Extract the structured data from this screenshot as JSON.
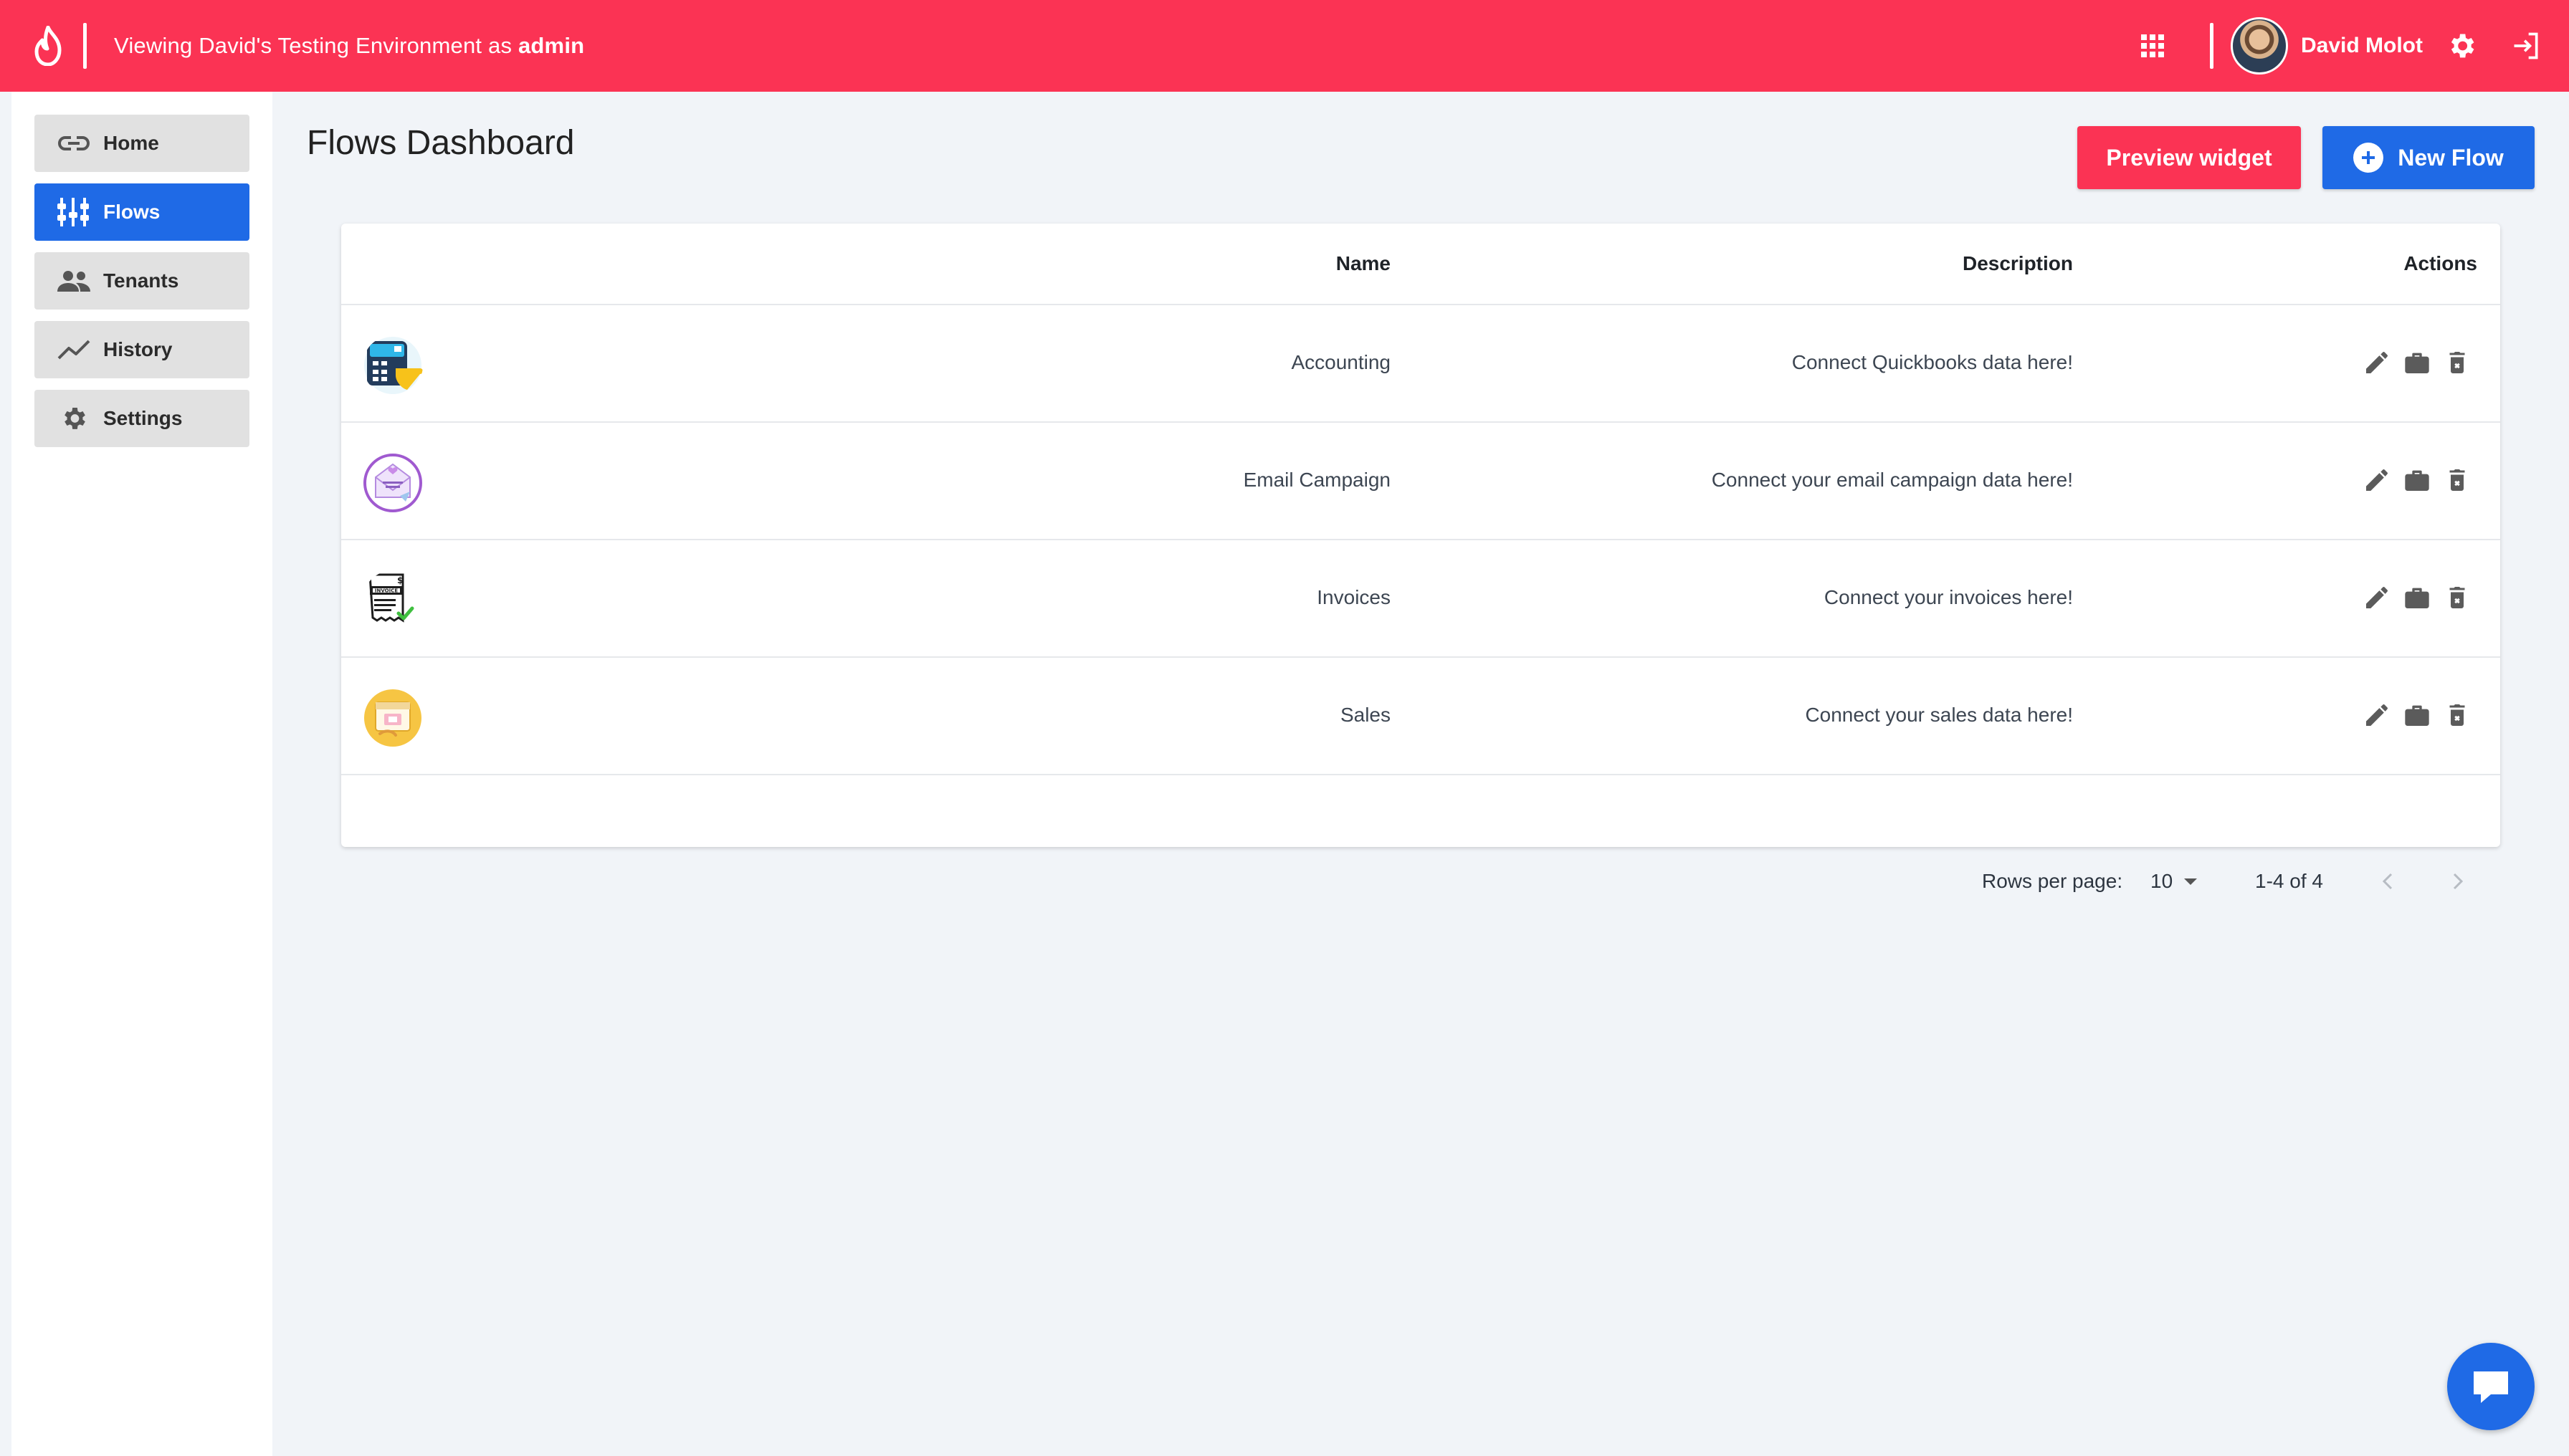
{
  "topbar": {
    "viewing_prefix": "Viewing David's Testing Environment as",
    "role": "admin",
    "user_name": "David Molot",
    "accent_color": "#fb3354"
  },
  "sidebar": {
    "items": [
      {
        "label": "Home",
        "icon": "link-icon",
        "active": false
      },
      {
        "label": "Flows",
        "icon": "flows-icon",
        "active": true
      },
      {
        "label": "Tenants",
        "icon": "people-icon",
        "active": false
      },
      {
        "label": "History",
        "icon": "trend-icon",
        "active": false
      },
      {
        "label": "Settings",
        "icon": "gear-icon",
        "active": false
      }
    ],
    "active_color": "#1f6ae6"
  },
  "main": {
    "title": "Flows Dashboard",
    "preview_label": "Preview widget",
    "new_flow_label": "New Flow"
  },
  "table": {
    "columns": {
      "name": "Name",
      "description": "Description",
      "actions": "Actions"
    },
    "rows": [
      {
        "name": "Accounting",
        "description": "Connect Quickbooks data here!",
        "icon": "accounting-icon"
      },
      {
        "name": "Email Campaign",
        "description": "Connect your email campaign data here!",
        "icon": "email-campaign-icon"
      },
      {
        "name": "Invoices",
        "description": "Connect your invoices here!",
        "icon": "invoice-icon"
      },
      {
        "name": "Sales",
        "description": "Connect your sales data here!",
        "icon": "sales-icon"
      }
    ],
    "row_actions": [
      "edit-icon",
      "briefcase-icon",
      "delete-icon"
    ]
  },
  "pagination": {
    "rows_per_page_label": "Rows per page:",
    "rows_per_page_value": "10",
    "range_text": "1-4 of 4"
  }
}
